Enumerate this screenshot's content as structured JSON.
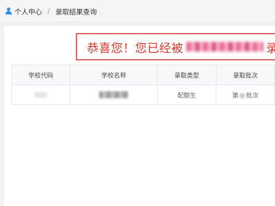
{
  "breadcrumb": {
    "home": "个人中心",
    "separator": "/",
    "current": "录取结果查询"
  },
  "banner": {
    "prefix": "恭喜您！您已经被",
    "suffix": "录"
  },
  "table": {
    "headers": [
      "学校代码",
      "学校名称",
      "录取类型",
      "录取批次"
    ],
    "row": {
      "type": "配额生",
      "batch_prefix": "第",
      "batch_suffix": "批次"
    }
  },
  "colors": {
    "accent": "#2d8cf0",
    "banner_border": "#e06666",
    "banner_text": "#d9362e"
  }
}
